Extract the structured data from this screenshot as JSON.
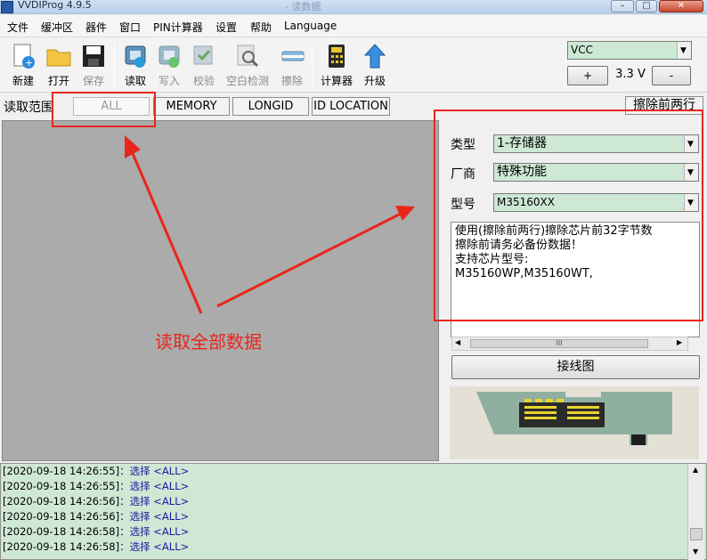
{
  "window": {
    "title": "VVDIProg 4.9.5",
    "subtitle": "- 读数据",
    "min": "–",
    "max": "□",
    "close": "✕"
  },
  "menu": [
    "文件",
    "缓冲区",
    "器件",
    "窗口",
    "PIN计算器",
    "设置",
    "帮助",
    "Language"
  ],
  "toolbar": {
    "new": "新建",
    "open": "打开",
    "save": "保存",
    "read": "读取",
    "write": "写入",
    "verify": "校验",
    "blank_check": "空白检测",
    "erase": "擦除",
    "calculator": "计算器",
    "upgrade": "升级"
  },
  "power": {
    "selected": "VCC",
    "voltage": "3.3 V",
    "plus": "+",
    "minus": "-"
  },
  "range": {
    "label": "读取范围",
    "all": "ALL",
    "memory": "MEMORY",
    "longid": "LONGID",
    "id_location": "ID LOCATION",
    "erase_first_two": "擦除前两行"
  },
  "device": {
    "type_label": "类型",
    "type_value": "1-存储器",
    "vendor_label": "厂商",
    "vendor_value": "特殊功能",
    "model_label": "型号",
    "model_value": "M35160XX",
    "info": [
      "使用(擦除前两行)擦除芯片前32字节数",
      "擦除前请务必备份数据！",
      "支持芯片型号:",
      "M35160WP,M35160WT,"
    ],
    "scroll_thumb": "III",
    "wiring_button": "接线图"
  },
  "log": [
    {
      "time": "[2020-09-18 14:26:55]",
      "msg": "：选择 <ALL>"
    },
    {
      "time": "[2020-09-18 14:26:55]",
      "msg": "：选择 <ALL>"
    },
    {
      "time": "[2020-09-18 14:26:56]",
      "msg": "：选择 <ALL>"
    },
    {
      "time": "[2020-09-18 14:26:56]",
      "msg": "：选择 <ALL>"
    },
    {
      "time": "[2020-09-18 14:26:58]",
      "msg": "：选择 <ALL>"
    },
    {
      "time": "[2020-09-18 14:26:58]",
      "msg": "：选择 <ALL>"
    }
  ],
  "annotation": {
    "text": "读取全部数据",
    "color": "#e8261c"
  }
}
